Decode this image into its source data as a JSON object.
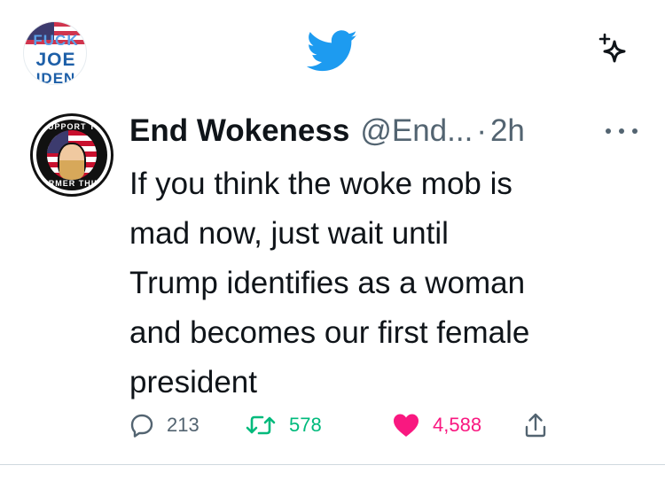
{
  "nav": {
    "logo_icon": "twitter-bird-icon",
    "brand_color": "#1d9bf0",
    "sparkle_icon": "sparkle-icon",
    "my_avatar": {
      "line1": "FUCK",
      "line2": "JOE",
      "line3": "IDEN"
    }
  },
  "tweet": {
    "avatar": {
      "top_text": "I SUPPORT THE",
      "bottom_text": "FORMER THING"
    },
    "display_name": "End Wokeness",
    "handle": "@End...",
    "separator": "·",
    "time": "2h",
    "text_lines": [
      "If you think the woke mob is",
      "mad now, just wait until",
      "Trump identifies as a woman",
      "and becomes our first female",
      "president"
    ],
    "actions": {
      "replies": "213",
      "retweets": "578",
      "likes": "4,588"
    },
    "colors": {
      "name": "#0f1419",
      "secondary": "#536471",
      "retweet": "#00ba7c",
      "like": "#f91880"
    }
  }
}
